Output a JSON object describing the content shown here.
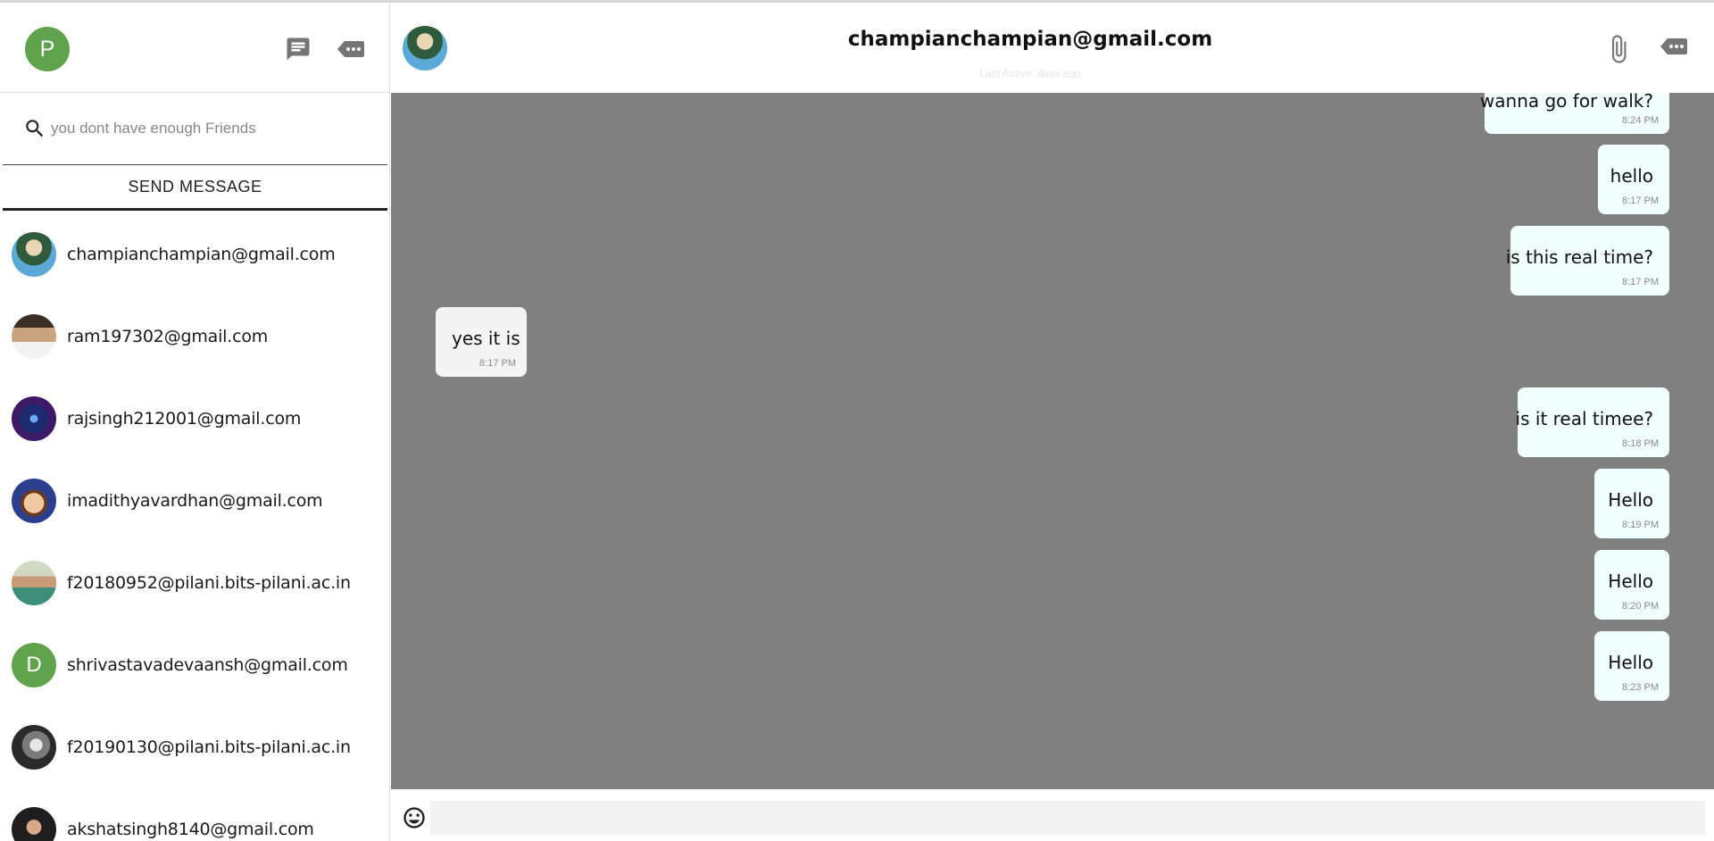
{
  "sidebar": {
    "user_initial": "P",
    "search_placeholder": "you dont have enough Friends",
    "send_message_label": "SEND MESSAGE",
    "contacts": [
      {
        "email": "champianchampian@gmail.com"
      },
      {
        "email": "ram197302@gmail.com"
      },
      {
        "email": "rajsingh212001@gmail.com"
      },
      {
        "email": "imadithyavardhan@gmail.com"
      },
      {
        "email": "f20180952@pilani.bits-pilani.ac.in"
      },
      {
        "email": "shrivastavadevaansh@gmail.com",
        "initial": "D"
      },
      {
        "email": "f20190130@pilani.bits-pilani.ac.in"
      },
      {
        "email": "akshatsingh8140@gmail.com"
      }
    ]
  },
  "chat": {
    "peer_name": "champianchampian@gmail.com",
    "peer_status": "Last Active: days ago",
    "messages": [
      {
        "text": "wanna go for walk?",
        "time": "8:24 PM",
        "direction": "out"
      },
      {
        "text": "hello",
        "time": "8:17 PM",
        "direction": "out"
      },
      {
        "text": "is this real time?",
        "time": "8:17 PM",
        "direction": "out"
      },
      {
        "text": "yes it is",
        "time": "8:17 PM",
        "direction": "in"
      },
      {
        "text": "is it real timee?",
        "time": "8:18 PM",
        "direction": "out"
      },
      {
        "text": "Hello",
        "time": "8:19 PM",
        "direction": "out"
      },
      {
        "text": "Hello",
        "time": "8:20 PM",
        "direction": "out"
      },
      {
        "text": "Hello",
        "time": "8:23 PM",
        "direction": "out"
      }
    ],
    "composer_value": ""
  },
  "colors": {
    "accent_green": "#5fa44c",
    "chat_background": "#808080",
    "outgoing_bubble": "#f0fffe",
    "incoming_bubble": "#f4f4f4",
    "icon_gray": "#757575"
  },
  "icons": {
    "chat": "chat-icon",
    "more": "more-icon",
    "search": "search-icon",
    "attach": "paperclip-icon",
    "emoji": "emoji-icon"
  }
}
